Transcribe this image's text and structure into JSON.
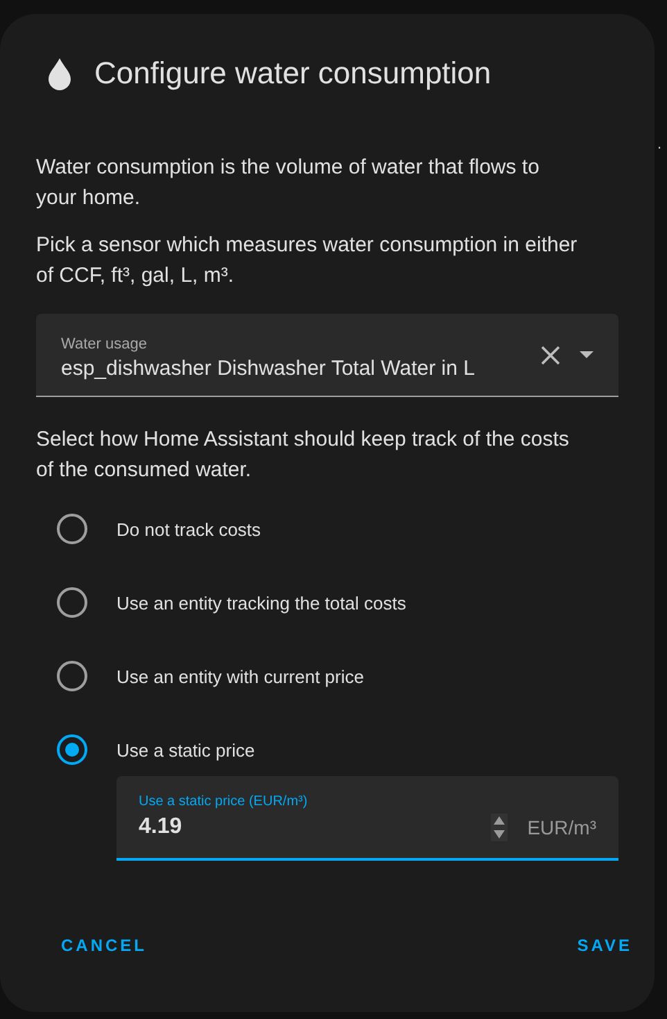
{
  "background_text": ".",
  "dialog": {
    "title": "Configure water consumption",
    "paragraphs": [
      "Water consumption is the volume of water that flows to your home.",
      "Pick a sensor which measures water consumption in either of CCF, ft³, gal, L, m³."
    ],
    "sensor_field": {
      "label": "Water usage",
      "value": "esp_dishwasher Dishwasher Total Water in L"
    },
    "cost_intro": "Select how Home Assistant should keep track of the costs of the consumed water.",
    "options": [
      {
        "label": "Do not track costs",
        "selected": false
      },
      {
        "label": "Use an entity tracking the total costs",
        "selected": false
      },
      {
        "label": "Use an entity with current price",
        "selected": false
      },
      {
        "label": "Use a static price",
        "selected": true
      }
    ],
    "price_field": {
      "label": "Use a static price (EUR/m³)",
      "value": "4.19",
      "suffix": "EUR/m³"
    },
    "buttons": [
      "CANCEL",
      "SAVE"
    ]
  }
}
